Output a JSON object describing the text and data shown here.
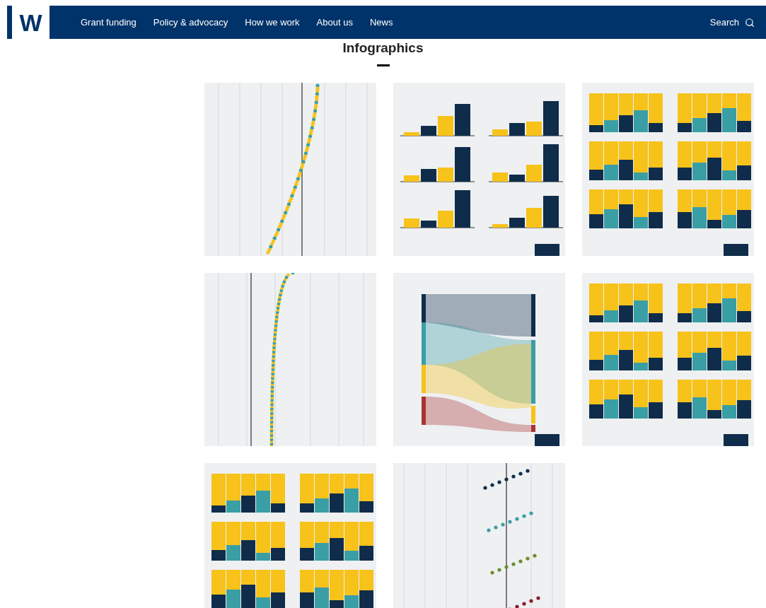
{
  "header": {
    "logo": "W",
    "nav": [
      "Grant funding",
      "Policy & advocacy",
      "How we work",
      "About us",
      "News"
    ],
    "search": "Search"
  },
  "page_title": "Infographics",
  "thumbnails": [
    {
      "kind": "dots"
    },
    {
      "kind": "grouped"
    },
    {
      "kind": "stacked"
    },
    {
      "kind": "line"
    },
    {
      "kind": "sankey"
    },
    {
      "kind": "stacked"
    },
    {
      "kind": "stacked"
    },
    {
      "kind": "regions"
    }
  ]
}
